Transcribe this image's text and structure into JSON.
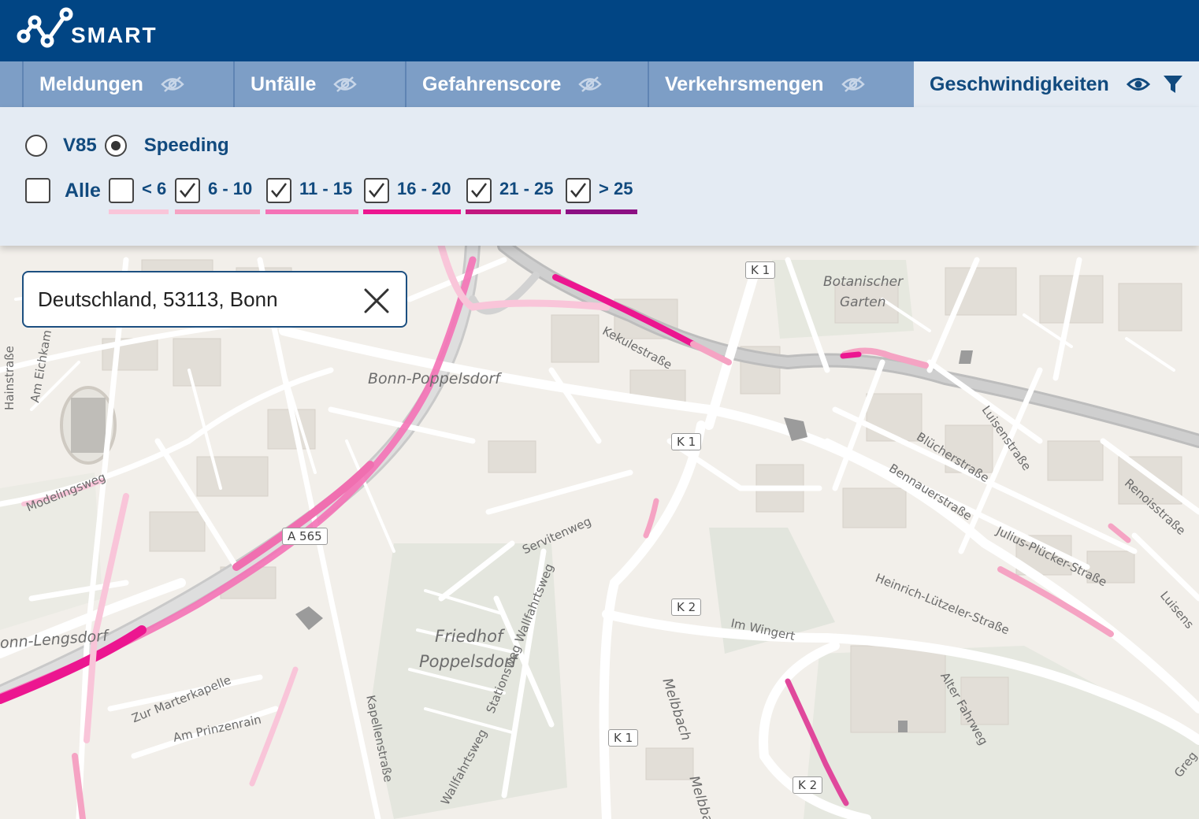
{
  "header": {
    "logo_text": "SMART"
  },
  "tabs": [
    {
      "label": "Meldungen",
      "visible": false
    },
    {
      "label": "Unfälle",
      "visible": false
    },
    {
      "label": "Gefahrenscore",
      "visible": false
    },
    {
      "label": "Verkehrsmengen",
      "visible": false
    },
    {
      "label": "Geschwindigkeiten",
      "visible": true,
      "active": true
    }
  ],
  "filter": {
    "modes": [
      {
        "label": "V85",
        "selected": false
      },
      {
        "label": "Speeding",
        "selected": true
      }
    ],
    "all_label": "Alle",
    "ranges": [
      {
        "label": "< 6",
        "checked": false,
        "color": "#f9c5d9"
      },
      {
        "label": "6 - 10",
        "checked": true,
        "color": "#f5a3c3"
      },
      {
        "label": "11 - 15",
        "checked": true,
        "color": "#f472b6"
      },
      {
        "label": "16 - 20",
        "checked": true,
        "color": "#ec1690"
      },
      {
        "label": "21 - 25",
        "checked": true,
        "color": "#c2187f"
      },
      {
        "label": "> 25",
        "checked": true,
        "color": "#8c1083"
      }
    ]
  },
  "search": {
    "value": "Deutschland, 53113, Bonn"
  },
  "map": {
    "places": {
      "poppelsdorf": "Bonn-Poppelsdorf",
      "botanic1": "Botanischer",
      "botanic2": "Garten",
      "friedhof1": "Friedhof",
      "friedhof2": "Poppelsdorf",
      "lengsdorf": "onn-Lengsdorf"
    },
    "streets": {
      "kekule": "Kekulestraße",
      "luisen": "Luisenstraße",
      "blucher": "Blücherstraße",
      "bennauer": "Bennauerstraße",
      "renois": "Renoisstraße",
      "julius": "Julius-Plücker-Straße",
      "heinrich": "Heinrich-Lützeler-Straße",
      "alter": "Alter Fahrweg",
      "imwingert": "Im Wingert",
      "servitenweg": "Servitenweg",
      "wallfahrt1": "Stationsweg Wallfahrtsweg",
      "wallfahrt2": "Wallfahrtsweg",
      "kapellen": "Kapellenstraße",
      "marterkapelle": "Zur Marterkapelle",
      "prinzenrain": "Am Prinzenrain",
      "melbbach": "Melbbach",
      "melbbach2": "Melbba",
      "hainstr": "Hainstraße",
      "eichkamp": "Am Eichkam",
      "modeling": "Modelingsweg",
      "luisens2": "Luisens",
      "greg": "Greg"
    },
    "shields": {
      "k1a": "K 1",
      "k1b": "K 1",
      "k1c": "K 1",
      "k2a": "K 2",
      "k2b": "K 2",
      "a565": "A 565"
    }
  }
}
